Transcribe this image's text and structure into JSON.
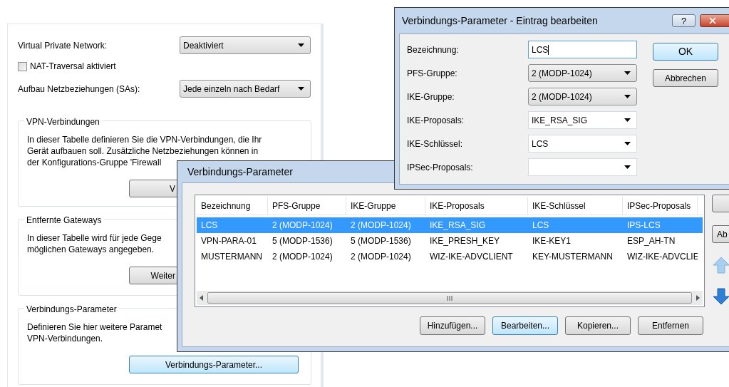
{
  "settings_panel": {
    "fields": [
      {
        "kind": "dropdown",
        "label": "Virtual Private Network:",
        "value": "Deaktiviert"
      },
      {
        "kind": "checkbox",
        "label": "NAT-Traversal aktiviert",
        "checked": false
      },
      {
        "kind": "dropdown",
        "label": "Aufbau Netzbeziehungen (SAs):",
        "value": "Jede einzeln nach Bedarf"
      }
    ],
    "groups": [
      {
        "title": "VPN-Verbindungen",
        "lines": [
          "In dieser Tabelle definieren Sie die VPN-Verbindungen, die Ihr",
          "Gerät aufbauen soll. Zusätzliche Netzbeziehungen können in",
          "der Konfigurations-Gruppe 'Firewall"
        ],
        "button": "V",
        "button_cut": true
      },
      {
        "title": "Entfernte Gateways",
        "lines": [
          "In dieser Tabelle wird für jede Gege",
          "möglichen Gateways angegeben."
        ],
        "button": "Weiter",
        "button_cut": true
      },
      {
        "title": "Verbindungs-Parameter",
        "lines": [
          "Definieren Sie hier weitere Paramet",
          "VPN-Verbindungen."
        ],
        "button": "Verbindungs-Parameter...",
        "button_cut": false
      }
    ]
  },
  "list_dialog": {
    "title": "Verbindungs-Parameter",
    "table": {
      "columns": [
        "Bezeichnung",
        "PFS-Gruppe",
        "IKE-Gruppe",
        "IKE-Proposals",
        "IKE-Schlüssel",
        "IPSec-Proposals"
      ],
      "rows": [
        {
          "cells": [
            "LCS",
            "2 (MODP-1024)",
            "2 (MODP-1024)",
            "IKE_RSA_SIG",
            "LCS",
            "IPS-LCS"
          ],
          "selected": true
        },
        {
          "cells": [
            "VPN-PARA-01",
            "5 (MODP-1536)",
            "5 (MODP-1536)",
            "IKE_PRESH_KEY",
            "IKE-KEY1",
            "ESP_AH-TN"
          ],
          "selected": false
        },
        {
          "cells": [
            "MUSTERMANN",
            "2 (MODP-1024)",
            "2 (MODP-1024)",
            "WIZ-IKE-ADVCLIENT",
            "KEY-MUSTERMANN",
            "WIZ-IKE-ADVCLIE"
          ],
          "selected": false
        }
      ]
    },
    "buttons": [
      {
        "label": "Hinzufügen...",
        "default": false
      },
      {
        "label": "Bearbeiten...",
        "default": true
      },
      {
        "label": "Kopieren...",
        "default": false
      },
      {
        "label": "Entfernen",
        "default": false
      }
    ],
    "side_buttons": [
      "Ab"
    ]
  },
  "edit_dialog": {
    "title": "Verbindungs-Parameter - Eintrag bearbeiten",
    "help_button": "?",
    "fields": [
      {
        "kind": "text",
        "label": "Bezeichnung:",
        "value": "LCS",
        "focused": true
      },
      {
        "kind": "dropdown",
        "label": "PFS-Gruppe:",
        "value": "2 (MODP-1024)"
      },
      {
        "kind": "dropdown",
        "label": "IKE-Gruppe:",
        "value": "2 (MODP-1024)"
      },
      {
        "kind": "combo",
        "label": "IKE-Proposals:",
        "value": "IKE_RSA_SIG"
      },
      {
        "kind": "combo",
        "label": "IKE-Schlüssel:",
        "value": "LCS"
      },
      {
        "kind": "combo",
        "label": "IPSec-Proposals:"
      }
    ],
    "buttons": [
      {
        "label": "OK",
        "default": true
      },
      {
        "label": "Abbrechen",
        "default": false
      }
    ]
  }
}
